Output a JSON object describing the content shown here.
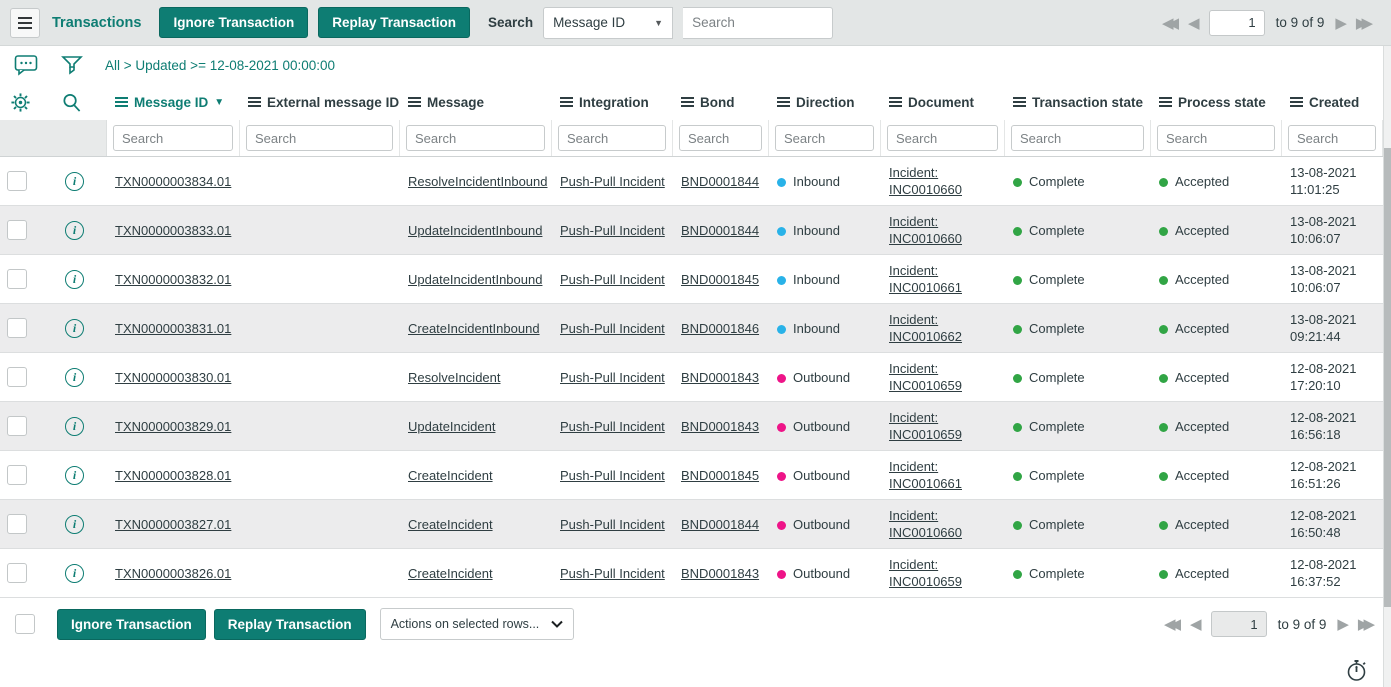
{
  "colors": {
    "accent": "#0e7d73",
    "toolbar_bg": "#e3e6e6",
    "inbound_dot": "#29b2e8",
    "outbound_dot": "#ee1488",
    "state_dot_green": "#31a545",
    "row_alt_bg": "#ececed",
    "text": "#2f3e42"
  },
  "icons": {
    "caret_down": "▼",
    "sort_desc": "▼",
    "first": "◀◀",
    "prev": "◀",
    "next": "▶",
    "last": "▶▶"
  },
  "toolbar": {
    "title": "Transactions",
    "ignore_button": "Ignore Transaction",
    "replay_button": "Replay Transaction",
    "search_label": "Search",
    "search_field_selected": "Message ID",
    "search_placeholder": "Search"
  },
  "pagination": {
    "page": "1",
    "range_text": "to 9 of 9"
  },
  "filterbar": {
    "breadcrumb": "All > Updated >= 12-08-2021 00:00:00"
  },
  "table": {
    "search_placeholder": "Search",
    "columns": [
      {
        "label": "Message ID",
        "sorted": true
      },
      {
        "label": "External message ID",
        "sorted": false
      },
      {
        "label": "Message",
        "sorted": false
      },
      {
        "label": "Integration",
        "sorted": false
      },
      {
        "label": "Bond",
        "sorted": false
      },
      {
        "label": "Direction",
        "sorted": false
      },
      {
        "label": "Document",
        "sorted": false
      },
      {
        "label": "Transaction state",
        "sorted": false
      },
      {
        "label": "Process state",
        "sorted": false
      },
      {
        "label": "Created",
        "sorted": false
      }
    ],
    "rows": [
      {
        "message_id": "TXN0000003834.01",
        "external_message_id": "",
        "message": "ResolveIncidentInbound",
        "integration": "Push-Pull Incident",
        "bond": "BND0001844",
        "direction": "Inbound",
        "document": [
          "Incident:",
          "INC0010660"
        ],
        "transaction_state": "Complete",
        "process_state": "Accepted",
        "created": [
          "13-08-2021",
          "11:01:25"
        ]
      },
      {
        "message_id": "TXN0000003833.01",
        "external_message_id": "",
        "message": "UpdateIncidentInbound",
        "integration": "Push-Pull Incident",
        "bond": "BND0001844",
        "direction": "Inbound",
        "document": [
          "Incident:",
          "INC0010660"
        ],
        "transaction_state": "Complete",
        "process_state": "Accepted",
        "created": [
          "13-08-2021",
          "10:06:07"
        ]
      },
      {
        "message_id": "TXN0000003832.01",
        "external_message_id": "",
        "message": "UpdateIncidentInbound",
        "integration": "Push-Pull Incident",
        "bond": "BND0001845",
        "direction": "Inbound",
        "document": [
          "Incident:",
          "INC0010661"
        ],
        "transaction_state": "Complete",
        "process_state": "Accepted",
        "created": [
          "13-08-2021",
          "10:06:07"
        ]
      },
      {
        "message_id": "TXN0000003831.01",
        "external_message_id": "",
        "message": "CreateIncidentInbound",
        "integration": "Push-Pull Incident",
        "bond": "BND0001846",
        "direction": "Inbound",
        "document": [
          "Incident:",
          "INC0010662"
        ],
        "transaction_state": "Complete",
        "process_state": "Accepted",
        "created": [
          "13-08-2021",
          "09:21:44"
        ]
      },
      {
        "message_id": "TXN0000003830.01",
        "external_message_id": "",
        "message": "ResolveIncident",
        "integration": "Push-Pull Incident",
        "bond": "BND0001843",
        "direction": "Outbound",
        "document": [
          "Incident:",
          "INC0010659"
        ],
        "transaction_state": "Complete",
        "process_state": "Accepted",
        "created": [
          "12-08-2021",
          "17:20:10"
        ]
      },
      {
        "message_id": "TXN0000003829.01",
        "external_message_id": "",
        "message": "UpdateIncident",
        "integration": "Push-Pull Incident",
        "bond": "BND0001843",
        "direction": "Outbound",
        "document": [
          "Incident:",
          "INC0010659"
        ],
        "transaction_state": "Complete",
        "process_state": "Accepted",
        "created": [
          "12-08-2021",
          "16:56:18"
        ]
      },
      {
        "message_id": "TXN0000003828.01",
        "external_message_id": "",
        "message": "CreateIncident",
        "integration": "Push-Pull Incident",
        "bond": "BND0001845",
        "direction": "Outbound",
        "document": [
          "Incident:",
          "INC0010661"
        ],
        "transaction_state": "Complete",
        "process_state": "Accepted",
        "created": [
          "12-08-2021",
          "16:51:26"
        ]
      },
      {
        "message_id": "TXN0000003827.01",
        "external_message_id": "",
        "message": "CreateIncident",
        "integration": "Push-Pull Incident",
        "bond": "BND0001844",
        "direction": "Outbound",
        "document": [
          "Incident:",
          "INC0010660"
        ],
        "transaction_state": "Complete",
        "process_state": "Accepted",
        "created": [
          "12-08-2021",
          "16:50:48"
        ]
      },
      {
        "message_id": "TXN0000003826.01",
        "external_message_id": "",
        "message": "CreateIncident",
        "integration": "Push-Pull Incident",
        "bond": "BND0001843",
        "direction": "Outbound",
        "document": [
          "Incident:",
          "INC0010659"
        ],
        "transaction_state": "Complete",
        "process_state": "Accepted",
        "created": [
          "12-08-2021",
          "16:37:52"
        ]
      }
    ]
  },
  "footer": {
    "ignore_button": "Ignore Transaction",
    "replay_button": "Replay Transaction",
    "actions_dropdown": "Actions on selected rows..."
  }
}
